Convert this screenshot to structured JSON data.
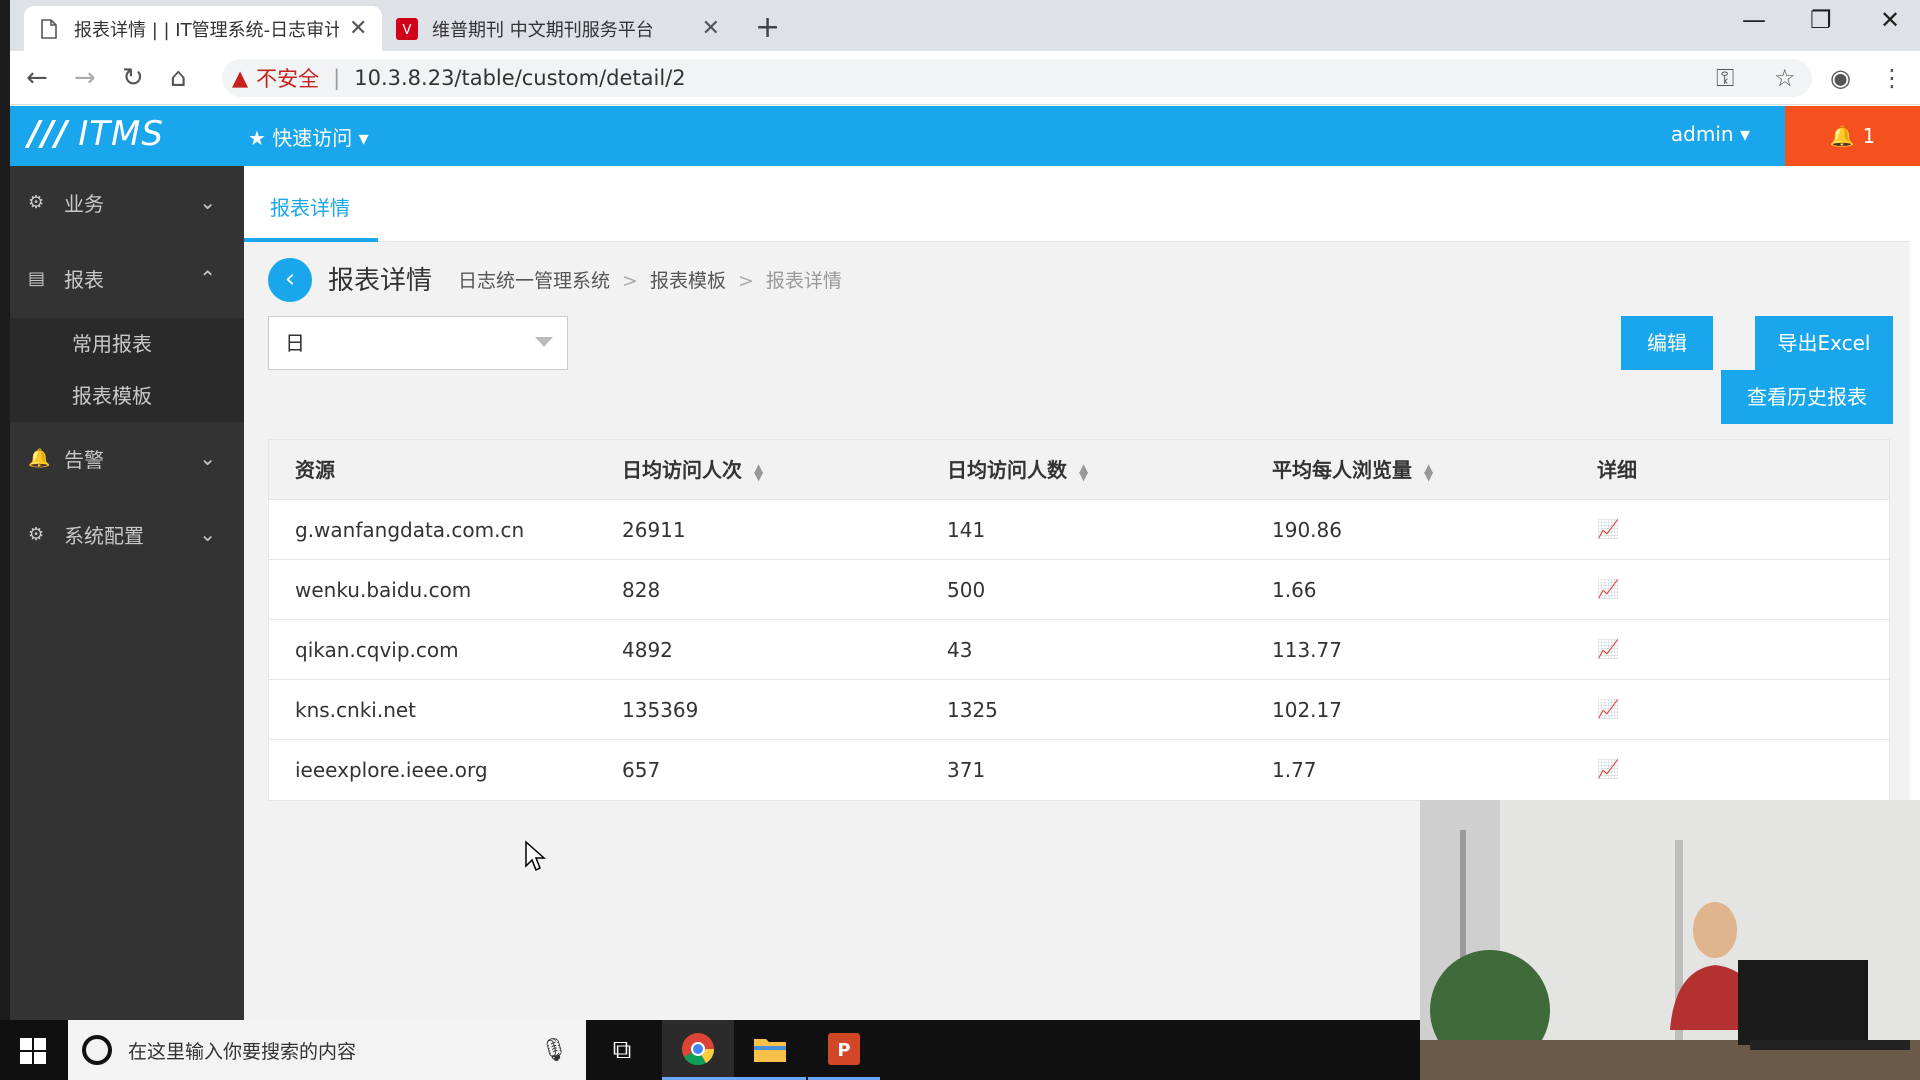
{
  "browser": {
    "tabs": [
      {
        "title": "报表详情 | | IT管理系统-日志审计",
        "active": true
      },
      {
        "title": "维普期刊 中文期刊服务平台",
        "active": false
      }
    ],
    "new_tab_symbol": "+",
    "security_label": "不安全",
    "url": "10.3.8.23/table/custom/detail/2"
  },
  "app": {
    "logo_text": "ITMS",
    "quick_access": "快速访问",
    "user": "admin",
    "notification_count": "1"
  },
  "sidebar": {
    "items": [
      {
        "label": "业务",
        "icon": "gear-icon",
        "expanded": false
      },
      {
        "label": "报表",
        "icon": "report-icon",
        "expanded": true
      },
      {
        "label": "告警",
        "icon": "bell-icon",
        "expanded": false
      },
      {
        "label": "系统配置",
        "icon": "gear-icon",
        "expanded": false
      }
    ],
    "report_sub": [
      "常用报表",
      "报表模板"
    ]
  },
  "main": {
    "tab_label": "报表详情",
    "page_title": "报表详情",
    "breadcrumb": [
      "日志统一管理系统",
      "报表模板",
      "报表详情"
    ],
    "select_value": "日",
    "buttons": {
      "edit": "编辑",
      "export": "导出Excel",
      "history": "查看历史报表"
    },
    "table": {
      "headers": [
        "资源",
        "日均访问人次",
        "日均访问人数",
        "平均每人浏览量",
        "详细"
      ],
      "rows": [
        [
          "g.wanfangdata.com.cn",
          "26911",
          "141",
          "190.86"
        ],
        [
          "wenku.baidu.com",
          "828",
          "500",
          "1.66"
        ],
        [
          "qikan.cqvip.com",
          "4892",
          "43",
          "113.77"
        ],
        [
          "kns.cnki.net",
          "135369",
          "1325",
          "102.17"
        ],
        [
          "ieeexplore.ieee.org",
          "657",
          "371",
          "1.77"
        ]
      ]
    }
  },
  "taskbar": {
    "search_placeholder": "在这里输入你要搜索的内容"
  },
  "colors": {
    "primary": "#19a6ec",
    "alert": "#f4511e",
    "sidebar": "#333333"
  }
}
